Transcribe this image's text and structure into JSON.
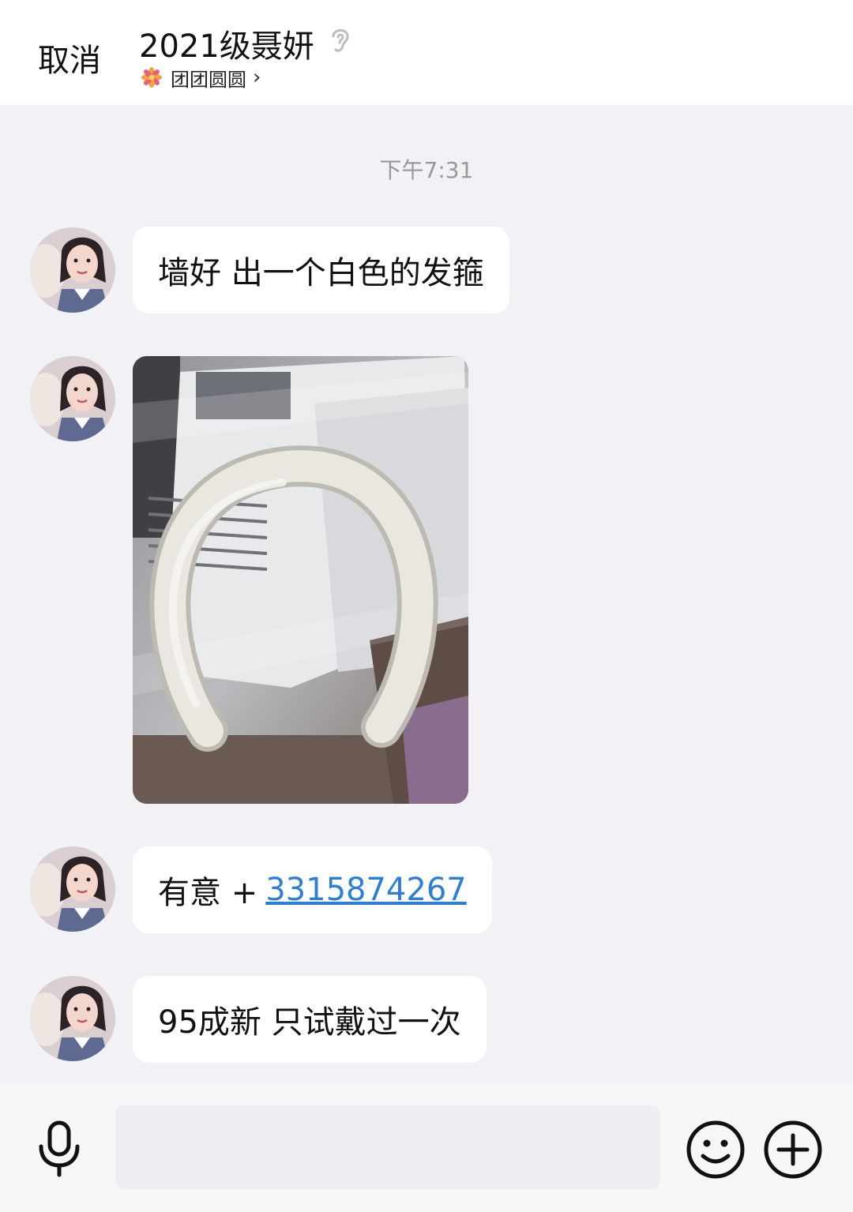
{
  "header": {
    "cancel_label": "取消",
    "title": "2021级聂妍",
    "group_name": "团团圆圆",
    "ear_icon": "ear-icon",
    "group_icon": "flower-icon"
  },
  "chat": {
    "timestamp": "下午7:31",
    "messages": [
      {
        "type": "text",
        "text": "墙好 出一个白色的发箍"
      },
      {
        "type": "image",
        "description_icon": "headband-photo"
      },
      {
        "type": "text",
        "text": "有意 +",
        "link": "3315874267"
      },
      {
        "type": "text",
        "text": "95成新 只试戴过一次"
      }
    ]
  },
  "input_bar": {
    "placeholder": "",
    "icons": [
      "microphone-icon",
      "emoji-icon",
      "plus-icon"
    ]
  },
  "colors": {
    "background": "#f2f1f6",
    "bubble": "#ffffff",
    "link": "#2d7fd6",
    "timestamp": "#999999"
  }
}
